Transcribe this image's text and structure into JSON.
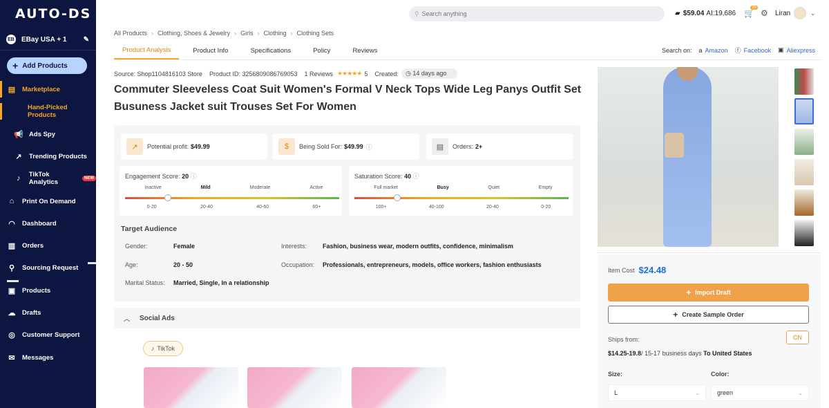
{
  "sidebar": {
    "logo": "AUTO-DS",
    "store": {
      "icon_text": "EB",
      "label": "EBay USA + 1"
    },
    "add_products": "Add Products",
    "items": [
      {
        "label": "Marketplace",
        "icon": "marketplace-icon"
      },
      {
        "label": "Hand-Picked Products",
        "icon": "star-icon"
      },
      {
        "label": "Ads Spy",
        "icon": "megaphone-icon"
      },
      {
        "label": "Trending Products",
        "icon": "chart-icon"
      },
      {
        "label": "TikTok Analytics",
        "icon": "tiktok-icon",
        "badge": "NEW"
      },
      {
        "label": "Print On Demand",
        "icon": "shop-icon"
      },
      {
        "label": "Dashboard",
        "icon": "gauge-icon"
      },
      {
        "label": "Orders",
        "icon": "document-icon"
      },
      {
        "label": "Sourcing Request",
        "icon": "sourcing-icon"
      },
      {
        "label": "Products",
        "icon": "box-icon"
      },
      {
        "label": "Drafts",
        "icon": "cloud-icon"
      },
      {
        "label": "Customer Support",
        "icon": "headset-icon"
      },
      {
        "label": "Messages",
        "icon": "mail-icon"
      }
    ]
  },
  "topbar": {
    "search_placeholder": "Search anything",
    "balance": "$59.04",
    "ai_credits": "AI:19,686",
    "cart_count": "35",
    "user": "Liran"
  },
  "breadcrumb": [
    "All Products",
    "Clothing, Shoes & Jewelry",
    "Girls",
    "Clothing",
    "Clothing Sets"
  ],
  "tabs": [
    "Product Analysis",
    "Product Info",
    "Specifications",
    "Policy",
    "Reviews"
  ],
  "search_on": {
    "label": "Search on:",
    "links": [
      "Amazon",
      "Facebook",
      "Aliexpress"
    ]
  },
  "meta": {
    "source": "Source: Shop1104816103 Store",
    "product_id": "Product ID: 3256809086769053",
    "reviews": "1 Reviews",
    "stars": "★★★★★",
    "rating": "5",
    "created_label": "Created:",
    "created": "14 days ago"
  },
  "title": "Commuter Sleeveless Coat Suit Women's Formal V Neck Tops Wide Leg Panys Outfit Set Busuness Jacket suit Trouses Set For Women",
  "stats": {
    "profit_label": "Potential profit:",
    "profit": "$49.99",
    "sold_label": "Being Sold For:",
    "sold": "$49.99",
    "orders_label": "Orders:",
    "orders": "2+"
  },
  "engagement": {
    "label": "Engagement Score:",
    "value": "20",
    "levels": [
      "Inactive",
      "Mild",
      "Moderate",
      "Active"
    ],
    "ranges": [
      "0-20",
      "20-40",
      "40-60",
      "60+"
    ],
    "active_index": 1,
    "level": 0.2
  },
  "saturation": {
    "label": "Saturation Score:",
    "value": "40",
    "levels": [
      "Full market",
      "Busy",
      "Quiet",
      "Empty"
    ],
    "ranges": [
      "100+",
      "40-100",
      "20-40",
      "0-20"
    ],
    "active_index": 1,
    "level": 0.2
  },
  "audience": {
    "title": "Target Audience",
    "gender_label": "Gender:",
    "gender": "Female",
    "age_label": "Age:",
    "age": "20 - 50",
    "marital_label": "Marital Status:",
    "marital": "Married, Single, In a relationship",
    "interests_label": "Interests:",
    "interests": "Fashion, business wear, modern outfits, confidence, minimalism",
    "occupation_label": "Occupation:",
    "occupation": "Professionals, entrepreneurs, models, office workers, fashion enthusiasts"
  },
  "social_ads": {
    "label": "Social Ads",
    "tiktok": "TikTok"
  },
  "right": {
    "cost_label": "Item Cost",
    "cost": "$24.48",
    "import": "Import Draft",
    "sample": "Create Sample Order",
    "ships_from": "Ships from:",
    "origin": "CN",
    "ship_price": "$14.25-19.8",
    "ship_days": "/ 15-17 business days",
    "ship_to": "To United States",
    "size_label": "Size:",
    "size": "L",
    "color_label": "Color:",
    "color": "green"
  },
  "colors": {
    "sidebar": "#0d1640",
    "accent": "#f5a623",
    "link": "#1e6fd9"
  }
}
